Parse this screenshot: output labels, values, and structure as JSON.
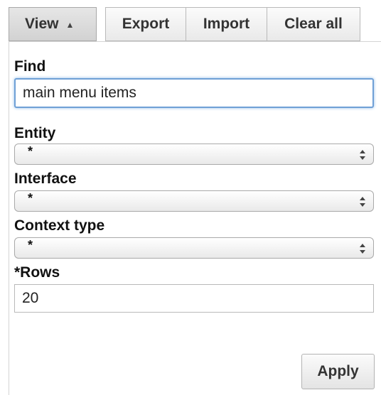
{
  "toolbar": {
    "view_label": "View",
    "view_caret_icon": "caret-up-icon",
    "export_label": "Export",
    "import_label": "Import",
    "clear_label": "Clear all"
  },
  "form": {
    "find": {
      "label": "Find",
      "value": "main menu items"
    },
    "entity": {
      "label": "Entity",
      "selected": "*"
    },
    "interface": {
      "label": "Interface",
      "selected": "*"
    },
    "context_type": {
      "label": "Context type",
      "selected": "*"
    },
    "rows": {
      "label": "*Rows",
      "value": "20"
    },
    "apply_label": "Apply"
  },
  "colors": {
    "focus_border": "#6fa0d6",
    "button_gradient_top": "#fbfbfb",
    "button_gradient_bottom": "#e4e4e4"
  }
}
